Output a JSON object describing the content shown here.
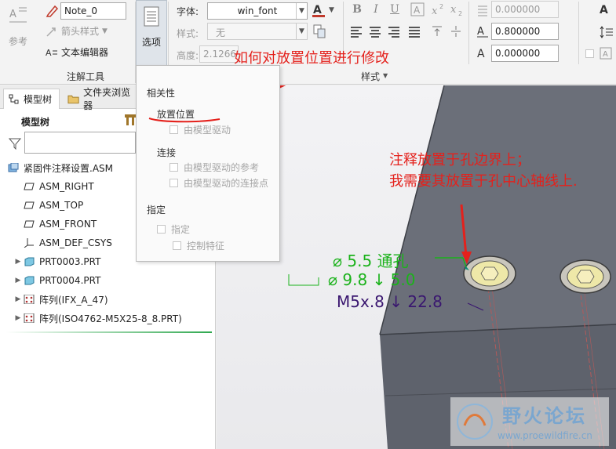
{
  "ribbon": {
    "ref_label": "参考",
    "note_name": "Note_0",
    "arrow_style_label": "箭头样式",
    "text_editor_label": "文本编辑器",
    "group_annotation_tools": "注解工具",
    "options_label": "选项",
    "font_label": "字体:",
    "font_value": "win_font",
    "style_label": "样式:",
    "style_value": "无",
    "height_label": "高度:",
    "height_value": "2.1266",
    "group_style": "样式",
    "num_field_1": "0.000000",
    "num_field_2": "0.800000",
    "num_field_3": "0.000000",
    "bold": "B",
    "italic": "I",
    "underline": "U"
  },
  "sidebar": {
    "tab_model_tree": "模型树",
    "tab_file_browser": "文件夹浏览器",
    "tree_title": "模型树",
    "items": [
      {
        "label": "紧固件注释设置.ASM",
        "icon": "assembly-icon"
      },
      {
        "label": "ASM_RIGHT",
        "icon": "datum-plane-icon"
      },
      {
        "label": "ASM_TOP",
        "icon": "datum-plane-icon"
      },
      {
        "label": "ASM_FRONT",
        "icon": "datum-plane-icon"
      },
      {
        "label": "ASM_DEF_CSYS",
        "icon": "csys-icon"
      },
      {
        "label": "PRT0003.PRT",
        "icon": "part-icon"
      },
      {
        "label": "PRT0004.PRT",
        "icon": "part-icon"
      },
      {
        "label": "阵列(IFX_A_47)",
        "icon": "pattern-icon"
      },
      {
        "label": "阵列(ISO4762-M5X25-8_8.PRT)",
        "icon": "pattern-icon"
      }
    ]
  },
  "panel": {
    "dependency": "相关性",
    "placement": "放置位置",
    "model_driven": "由模型驱动",
    "connection": "连接",
    "model_driven_ref": "由模型驱动的参考",
    "model_driven_conn_point": "由模型驱动的连接点",
    "assign": "指定",
    "assign_opt": "指定",
    "control_feature": "控制特征"
  },
  "annotations": {
    "question": "如何对放置位置进行修改",
    "note_line1": "注释放置于孔边界上；",
    "note_line2": "我需要其放置于孔中心轴线上.",
    "dim1": "⌀  5.5  通孔",
    "dim2": "⌀  9.8 ↓  5.0",
    "dim3": "M5x.8 ↓ 22.8"
  },
  "watermark": {
    "title": "野火论坛",
    "url": "www.proewildfire.cn"
  },
  "colors": {
    "annotation_red": "#e4211c",
    "dim_green": "#1bb21b",
    "dim_purple": "#3a1770",
    "part_face": "#6b6f79"
  }
}
